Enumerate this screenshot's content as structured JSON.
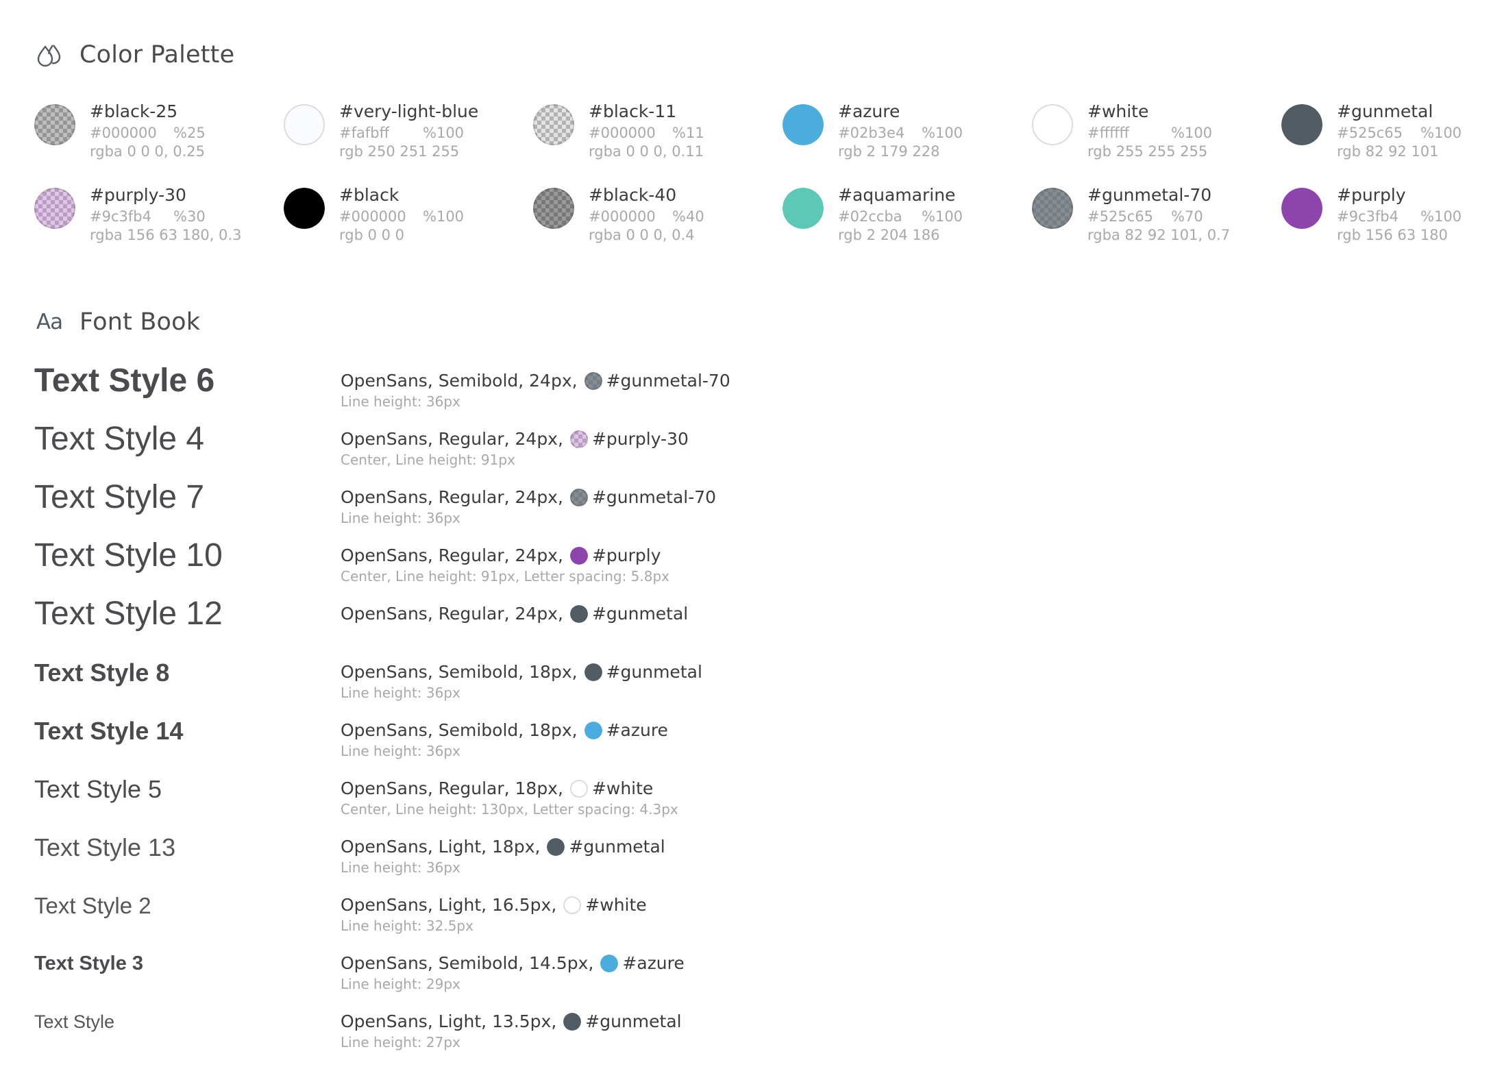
{
  "palette": {
    "title": "Color Palette",
    "icon": "drops-icon",
    "swatches": [
      {
        "name": "#black-25",
        "hex": "#000000",
        "opacity": "%25",
        "rgb": "rgba 0 0 0, 0.25",
        "color": "#000000",
        "alpha": 0.25
      },
      {
        "name": "#very-light-blue",
        "hex": "#fafbff",
        "opacity": "%100",
        "rgb": "rgb 250 251 255",
        "color": "#fafbff",
        "alpha": 1
      },
      {
        "name": "#black-11",
        "hex": "#000000",
        "opacity": "%11",
        "rgb": "rgba 0 0 0, 0.11",
        "color": "#000000",
        "alpha": 0.11
      },
      {
        "name": "#azure",
        "hex": "#02b3e4",
        "opacity": "%100",
        "rgb": "rgb 2 179 228",
        "color": "#4badde",
        "alpha": 1
      },
      {
        "name": "#white",
        "hex": "#ffffff",
        "opacity": "%100",
        "rgb": "rgb 255 255 255",
        "color": "#ffffff",
        "alpha": 1
      },
      {
        "name": "#gunmetal",
        "hex": "#525c65",
        "opacity": "%100",
        "rgb": "rgb 82 92 101",
        "color": "#525c65",
        "alpha": 1
      },
      {
        "name": "#purply-30",
        "hex": "#9c3fb4",
        "opacity": "%30",
        "rgb": "rgba 156 63 180, 0.3",
        "color": "#9c3fb4",
        "alpha": 0.3
      },
      {
        "name": "#black",
        "hex": "#000000",
        "opacity": "%100",
        "rgb": "rgb 0 0 0",
        "color": "#000000",
        "alpha": 1
      },
      {
        "name": "#black-40",
        "hex": "#000000",
        "opacity": "%40",
        "rgb": "rgba 0 0 0, 0.4",
        "color": "#000000",
        "alpha": 0.4
      },
      {
        "name": "#aquamarine",
        "hex": "#02ccba",
        "opacity": "%100",
        "rgb": "rgb 2 204 186",
        "color": "#5cc8b5",
        "alpha": 1
      },
      {
        "name": "#gunmetal-70",
        "hex": "#525c65",
        "opacity": "%70",
        "rgb": "rgba 82 92 101, 0.7",
        "color": "#525c65",
        "alpha": 0.7
      },
      {
        "name": "#purply",
        "hex": "#9c3fb4",
        "opacity": "%100",
        "rgb": "rgb 156 63 180",
        "color": "#8e44ad",
        "alpha": 1
      }
    ]
  },
  "fontbook": {
    "title": "Font Book",
    "icon_glyph": "Aa",
    "styles": [
      {
        "label": "Text Style 6",
        "size": 48,
        "weight": 700,
        "spec": "OpenSans, Semibold, 24px,",
        "color_name": "#gunmetal-70",
        "color": "#525c65",
        "alpha": 0.7,
        "note": "Line height: 36px"
      },
      {
        "label": "Text Style 4",
        "size": 48,
        "weight": 400,
        "spec": "OpenSans, Regular, 24px,",
        "color_name": "#purply-30",
        "color": "#9c3fb4",
        "alpha": 0.3,
        "note": "Center, Line height: 91px"
      },
      {
        "label": "Text Style 7",
        "size": 48,
        "weight": 400,
        "spec": "OpenSans, Regular, 24px,",
        "color_name": "#gunmetal-70",
        "color": "#525c65",
        "alpha": 0.7,
        "note": "Line height: 36px"
      },
      {
        "label": "Text Style 10",
        "size": 48,
        "weight": 400,
        "spec": "OpenSans, Regular, 24px,",
        "color_name": "#purply",
        "color": "#8e44ad",
        "alpha": 1,
        "note": "Center, Line height: 91px, Letter spacing: 5.8px"
      },
      {
        "label": "Text Style 12",
        "size": 48,
        "weight": 400,
        "spec": "OpenSans, Regular, 24px,",
        "color_name": "#gunmetal",
        "color": "#525c65",
        "alpha": 1,
        "note": ""
      },
      {
        "label": "Text Style 8",
        "size": 36,
        "weight": 700,
        "spec": "OpenSans, Semibold, 18px,",
        "color_name": "#gunmetal",
        "color": "#525c65",
        "alpha": 1,
        "note": "Line height: 36px"
      },
      {
        "label": "Text Style 14",
        "size": 36,
        "weight": 700,
        "spec": "OpenSans, Semibold, 18px,",
        "color_name": "#azure",
        "color": "#4badde",
        "alpha": 1,
        "note": "Line height: 36px"
      },
      {
        "label": "Text Style 5",
        "size": 36,
        "weight": 400,
        "spec": "OpenSans, Regular, 18px,",
        "color_name": "#white",
        "color": "#ffffff",
        "alpha": 1,
        "note": "Center, Line height: 130px, Letter spacing: 4.3px"
      },
      {
        "label": "Text Style 13",
        "size": 36,
        "weight": 300,
        "spec": "OpenSans, Light, 18px,",
        "color_name": "#gunmetal",
        "color": "#525c65",
        "alpha": 1,
        "note": "Line height: 36px"
      },
      {
        "label": "Text Style 2",
        "size": 33,
        "weight": 300,
        "spec": "OpenSans, Light, 16.5px,",
        "color_name": "#white",
        "color": "#ffffff",
        "alpha": 1,
        "note": "Line height: 32.5px"
      },
      {
        "label": "Text Style 3",
        "size": 29,
        "weight": 700,
        "spec": "OpenSans, Semibold, 14.5px,",
        "color_name": "#azure",
        "color": "#4badde",
        "alpha": 1,
        "note": "Line height: 29px"
      },
      {
        "label": "Text Style",
        "size": 27,
        "weight": 300,
        "spec": "OpenSans, Light, 13.5px,",
        "color_name": "#gunmetal",
        "color": "#525c65",
        "alpha": 1,
        "note": "Line height: 27px"
      }
    ]
  }
}
